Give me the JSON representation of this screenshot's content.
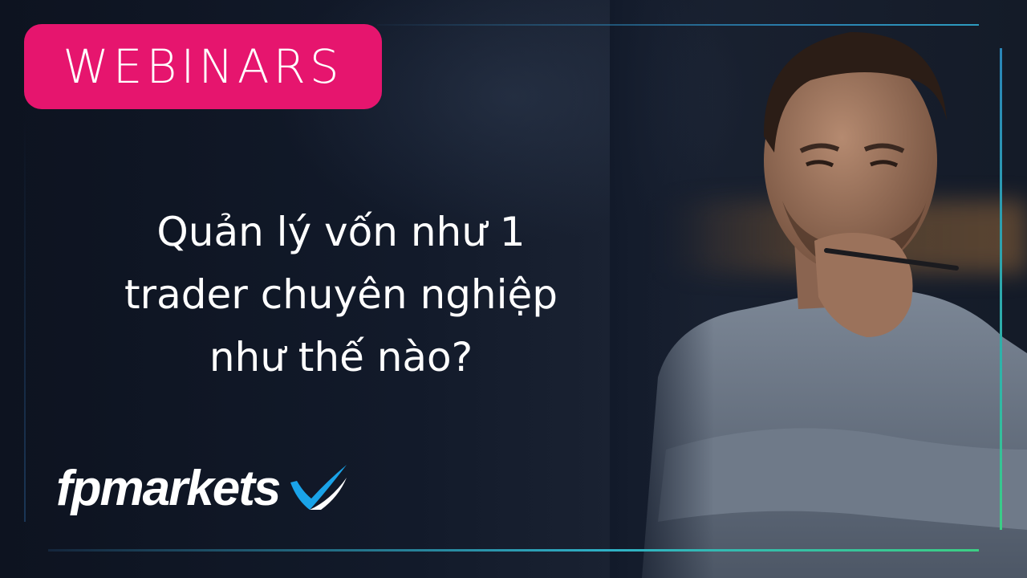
{
  "badge": {
    "label": "WEBINARS",
    "color": "#e6156e"
  },
  "headline": {
    "lines": [
      "Quản lý vốn như 1",
      "trader chuyên nghiệp",
      "như thế nào?"
    ]
  },
  "brand": {
    "name": "fpmarkets",
    "icon": "checkmark-swoosh-icon",
    "accent": "#1aa3e8"
  },
  "frame": {
    "accent_start": "#2a7fae",
    "accent_end": "#3ccf84"
  }
}
